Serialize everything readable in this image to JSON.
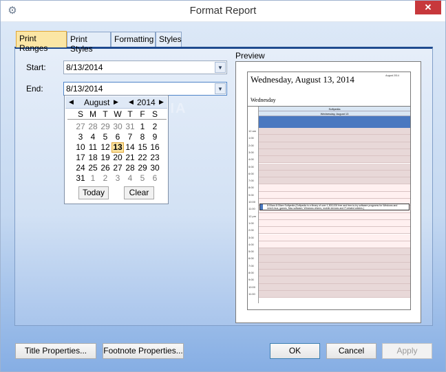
{
  "window": {
    "title": "Format Report",
    "close_symbol": "✕",
    "gear_icon": "gear-icon"
  },
  "tabs": [
    {
      "label": "Print Ranges",
      "active": true
    },
    {
      "label": "Print Styles",
      "active": false
    },
    {
      "label": "Formatting",
      "active": false
    },
    {
      "label": "Styles",
      "active": false
    }
  ],
  "ranges": {
    "start_label": "Start:",
    "start_value": "8/13/2014",
    "end_label": "End:",
    "end_value": "8/13/2014"
  },
  "calendar": {
    "month": "August",
    "year": "2014",
    "dow": [
      "S",
      "M",
      "T",
      "W",
      "T",
      "F",
      "S"
    ],
    "weeks": [
      [
        "27",
        "28",
        "29",
        "30",
        "31",
        "1",
        "2"
      ],
      [
        "3",
        "4",
        "5",
        "6",
        "7",
        "8",
        "9"
      ],
      [
        "10",
        "11",
        "12",
        "13",
        "14",
        "15",
        "16"
      ],
      [
        "17",
        "18",
        "19",
        "20",
        "21",
        "22",
        "23"
      ],
      [
        "24",
        "25",
        "26",
        "27",
        "28",
        "29",
        "30"
      ],
      [
        "31",
        "1",
        "2",
        "3",
        "4",
        "5",
        "6"
      ]
    ],
    "selected": "13",
    "today_button": "Today",
    "clear_button": "Clear"
  },
  "preview": {
    "label": "Preview",
    "page_title": "Wednesday, August 13, 2014",
    "page_subtitle": "Wednesday",
    "header1": "Softpedia",
    "header2": "Wednesday, August 13",
    "times": [
      "12 am",
      "1:00",
      "2:00",
      "3:00",
      "4:00",
      "5:00",
      "6:00",
      "7:00",
      "8:00",
      "9:00",
      "10:00",
      "11:00",
      "12 pm",
      "1:00",
      "2:00",
      "3:00",
      "4:00",
      "5:00",
      "6:00",
      "7:00",
      "8:00",
      "9:00",
      "10:00",
      "11:00"
    ],
    "appointment": "8:00am-8:30am Softpedia (Softpedia is a library of over 1,500,000 free and free-to-try software programs for Windows and Unix/Linux, games, Mac software, Windows drivers, mobile devices and IT-related articles.)",
    "mini_calendar_title": "August 2014"
  },
  "watermark": "SOFTPEDIA",
  "buttons": {
    "title_properties": "Title Properties...",
    "footnote_properties": "Footnote Properties...",
    "ok": "OK",
    "cancel": "Cancel",
    "apply": "Apply"
  }
}
